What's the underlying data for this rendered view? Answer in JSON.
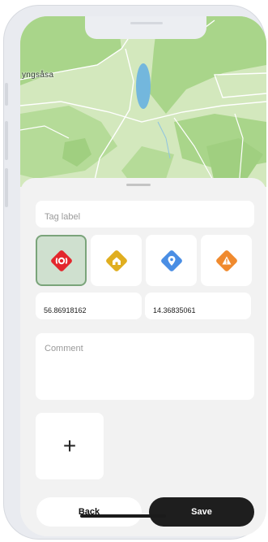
{
  "map": {
    "place_label": "yngsåsa"
  },
  "form": {
    "tag_label_placeholder": "Tag label",
    "latitude": "56.86918162",
    "longitude": "14.36835061",
    "comment_placeholder": "Comment",
    "add_photo_label": "+"
  },
  "tag_icons": [
    {
      "name": "alarm-icon",
      "color": "#e3262c",
      "selected": true
    },
    {
      "name": "home-icon",
      "color": "#e0ae1f",
      "selected": false
    },
    {
      "name": "location-pin-icon",
      "color": "#4a8ee4",
      "selected": false
    },
    {
      "name": "warning-icon",
      "color": "#f08a2e",
      "selected": false
    }
  ],
  "actions": {
    "back_label": "Back",
    "save_label": "Save"
  }
}
